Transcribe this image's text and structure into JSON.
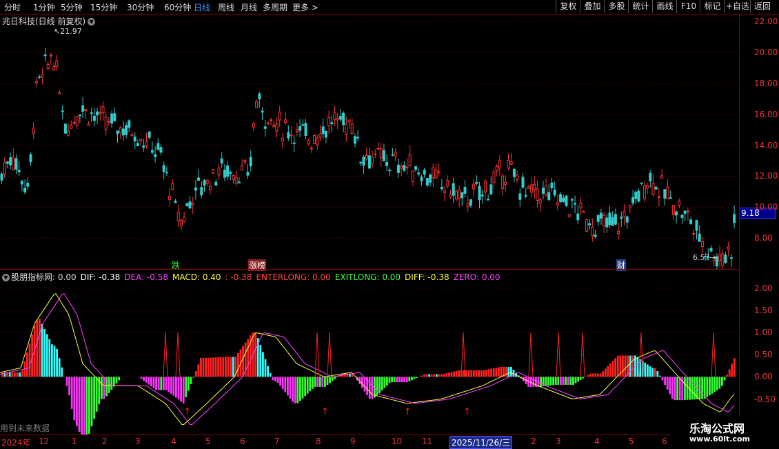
{
  "toolbar": {
    "periods": [
      "分时",
      "1分钟",
      "5分钟",
      "15分钟",
      "30分钟",
      "60分钟",
      "日线",
      "周线",
      "月线",
      "多周期",
      "更多"
    ],
    "active_period": "日线",
    "right_buttons": [
      "复权",
      "叠加",
      "多股",
      "统计",
      "画线",
      "F10",
      "标记",
      "+自选",
      "返回"
    ]
  },
  "main_chart": {
    "title": "兆日科技(日线 前复权)",
    "high_label": "21.97",
    "low_label": "6.57",
    "current_price": "9.18",
    "price_ticks": [
      "22.00",
      "20.00",
      "18.00",
      "16.00",
      "14.00",
      "12.00",
      "10.00",
      "8.00"
    ],
    "events": [
      "跌",
      "涨榜",
      "财"
    ]
  },
  "indicator": {
    "name": "股朋指标网",
    "values": [
      {
        "text": ": 0.00",
        "color": "#dddddd"
      },
      {
        "text": "DIF: -0.38",
        "color": "#ffffff"
      },
      {
        "text": "DEA: -0.58",
        "color": "#ff44ff"
      },
      {
        "text": "MACD: 0.40",
        "color": "#ffff44"
      },
      {
        "text": ": -0.38",
        "color": "#ff4444"
      },
      {
        "text": "ENTERLONG: 0.00",
        "color": "#ff4444"
      },
      {
        "text": "EXITLONG: 0.00",
        "color": "#44ff44"
      },
      {
        "text": "DIFF: -0.38",
        "color": "#ffff44"
      },
      {
        "text": "ZERO: 0.00",
        "color": "#ff44ff"
      }
    ],
    "ticks": [
      "2.00",
      "1.50",
      "1.00",
      "0.50",
      "0.00",
      "-0.50"
    ]
  },
  "bottom": {
    "year": "2024年",
    "months": [
      "12",
      "1",
      "2",
      "3",
      "4",
      "5",
      "6",
      "7",
      "8",
      "9",
      "10",
      "11",
      "2",
      "3",
      "4",
      "5",
      "6"
    ],
    "cursor_date": "2025/11/26/三",
    "watermark": "用到未来数据"
  },
  "logo": {
    "name": "乐淘公式网",
    "url": "www.60lt.com"
  },
  "colors": {
    "up": "#ff3333",
    "down": "#33cccc",
    "dif": "#ffff44",
    "dea": "#ff44ff",
    "border": "#8b0000"
  }
}
